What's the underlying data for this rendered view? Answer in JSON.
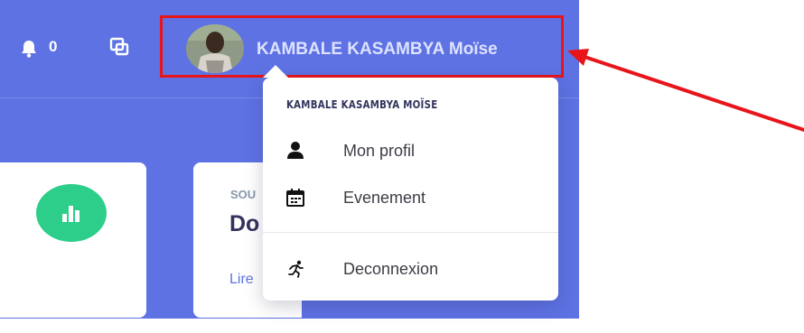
{
  "navbar": {
    "notification_count": "0",
    "user_name": "KAMBALE KASAMBYA Moïse"
  },
  "cards": {
    "right_eyebrow": "SOU",
    "right_title": "Do",
    "right_link": "Lire"
  },
  "dropdown": {
    "header": "KAMBALE KASAMBYA MOÏSE",
    "items": [
      {
        "label": "Mon profil",
        "icon": "user-icon"
      },
      {
        "label": "Evenement",
        "icon": "calendar-icon"
      },
      {
        "label": "Deconnexion",
        "icon": "running-icon"
      }
    ]
  },
  "colors": {
    "navbar_background": "#5e72e4",
    "highlight_box": "#e8141a",
    "annotation_arrow": "#e8141a",
    "stat_icon": "#2dce89"
  }
}
